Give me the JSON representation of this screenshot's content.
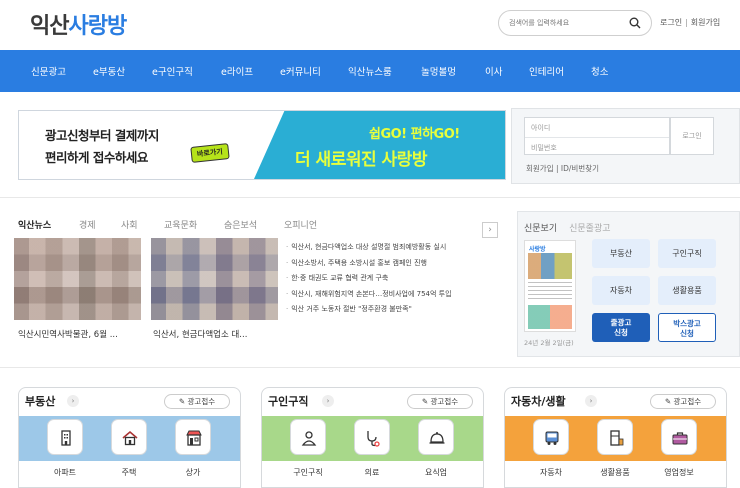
{
  "header": {
    "logo_part1": "익산",
    "logo_part2": "사랑방",
    "search_placeholder": "검색어를 입력하세요",
    "login_link": "로그인",
    "signup_link": "회원가입"
  },
  "nav": [
    "신문광고",
    "e부동산",
    "e구인구직",
    "e라이프",
    "e커뮤니티",
    "익산뉴스룸",
    "놀멍볼멍",
    "이사",
    "인테리어",
    "청소"
  ],
  "banner": {
    "line1": "광고신청부터 결제까지",
    "line2": "편리하게 접수하세요",
    "go_label": "바로가기",
    "right_line1": "쉽GO! 편하GO!",
    "right_line2": "더 새로워진 사랑방"
  },
  "login": {
    "id_placeholder": "아이디",
    "pw_placeholder": "비밀번호",
    "button": "로그인",
    "links": "회원가입 | ID/비번찾기"
  },
  "news": {
    "tabs": [
      "익산뉴스",
      "경제",
      "사회",
      "교육문화",
      "숨은보석",
      "오피니언"
    ],
    "arrow": "›",
    "captions": [
      "익산시민역사박물관, 6월 ...",
      "익산서, 현금다액업소 대..."
    ],
    "headlines": [
      "익산서, 현금다액업소 대상 설명절 범죄예방활동 실시",
      "익산소방서, 주택용 소방시설 홍보 캠페인 진행",
      "한·중 태권도 교류 협력 관계 구축",
      "익산시, 재해위험지역 손본다…정비사업에 754억 투입",
      "익산 거주 노동자 절반 \"정주환경 불만족\""
    ]
  },
  "paper": {
    "tab_active": "신문보기",
    "tab_inactive": "신문줄광고",
    "masthead": "사랑방",
    "date": "24년 2월 2일(금)",
    "categories": [
      "부동산",
      "구인구직",
      "자동차",
      "생활용품"
    ],
    "cta1_l1": "줄광고",
    "cta1_l2": "신청",
    "cta2_l1": "박스광고",
    "cta2_l2": "신청"
  },
  "boxes": [
    {
      "title": "부동산",
      "ad": "광고접수",
      "color": "#9dc8e8",
      "items": [
        "아파트",
        "주택",
        "상가"
      ],
      "icons": [
        "apartment-icon",
        "house-icon",
        "store-icon"
      ]
    },
    {
      "title": "구인구직",
      "ad": "광고접수",
      "color": "#a8d88a",
      "items": [
        "구인구직",
        "의료",
        "요식업"
      ],
      "icons": [
        "person-icon",
        "stethoscope-icon",
        "cloche-icon"
      ]
    },
    {
      "title": "자동차/생활",
      "ad": "광고접수",
      "color": "#f4a23c",
      "items": [
        "자동차",
        "생활용품",
        "영업정보"
      ],
      "icons": [
        "bus-icon",
        "appliance-icon",
        "briefcase-icon"
      ]
    }
  ]
}
